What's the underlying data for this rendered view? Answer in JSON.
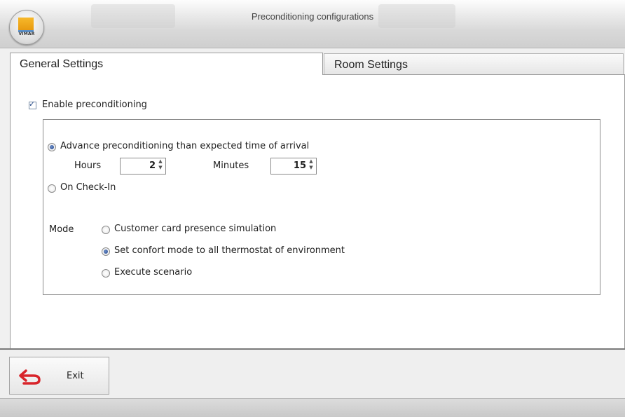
{
  "window": {
    "title": "Preconditioning configurations",
    "logo_text": "VIMAR"
  },
  "tabs": [
    {
      "label": "General Settings",
      "active": true
    },
    {
      "label": "Room Settings",
      "active": false
    }
  ],
  "general": {
    "enable_label": "Enable preconditioning",
    "enable_checked": true,
    "advance": {
      "label": "Advance preconditioning than expected time of arrival",
      "selected": true,
      "hours_label": "Hours",
      "hours_value": "2",
      "minutes_label": "Minutes",
      "minutes_value": "15"
    },
    "checkin": {
      "label": "On Check-In",
      "selected": false
    },
    "mode": {
      "label": "Mode",
      "options": [
        {
          "label": "Customer card presence simulation",
          "selected": false
        },
        {
          "label": "Set confort mode to all thermostat of environment",
          "selected": true
        },
        {
          "label": "Execute scenario",
          "selected": false
        }
      ]
    }
  },
  "footer": {
    "exit_label": "Exit"
  },
  "colors": {
    "exit_icon": "#d8242a",
    "radio_dot": "#24448a",
    "checkbox_border": "#7a8ea6"
  }
}
